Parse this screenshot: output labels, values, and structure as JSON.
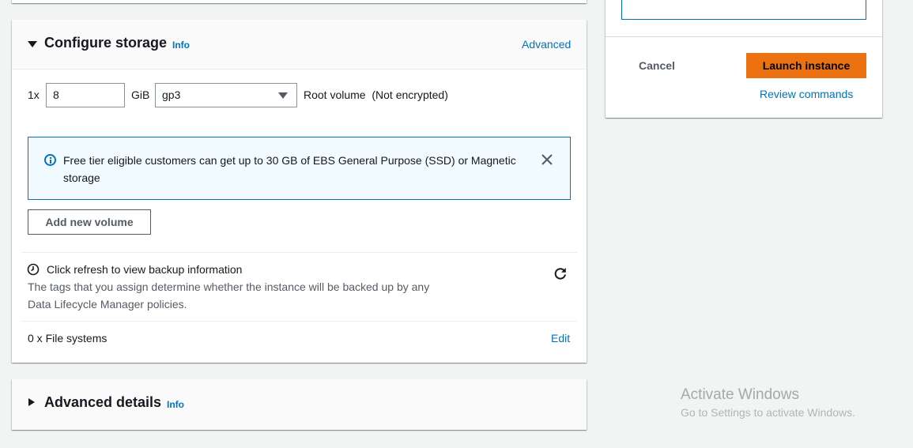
{
  "storage": {
    "title": "Configure storage",
    "info": "Info",
    "advanced_link": "Advanced",
    "count_prefix": "1x",
    "size_value": "8",
    "size_unit": "GiB",
    "volume_type": "gp3",
    "volume_label": "Root volume",
    "volume_status": "(Not encrypted)",
    "alert_text": "Free tier eligible customers can get up to 30 GB of EBS General Purpose (SSD) or Magnetic storage",
    "add_volume_label": "Add new volume",
    "backup_title": "Click refresh to view backup information",
    "backup_desc": "The tags that you assign determine whether the instance will be backed up by any Data Lifecycle Manager policies.",
    "file_systems": "0 x File systems",
    "edit_label": "Edit"
  },
  "advanced_details": {
    "title": "Advanced details",
    "info": "Info"
  },
  "summary": {
    "cancel_label": "Cancel",
    "launch_label": "Launch instance",
    "review_label": "Review commands"
  },
  "watermark": {
    "title": "Activate Windows",
    "subtitle": "Go to Settings to activate Windows."
  },
  "colors": {
    "accent": "#0073bb",
    "primary_button": "#ec7211"
  }
}
